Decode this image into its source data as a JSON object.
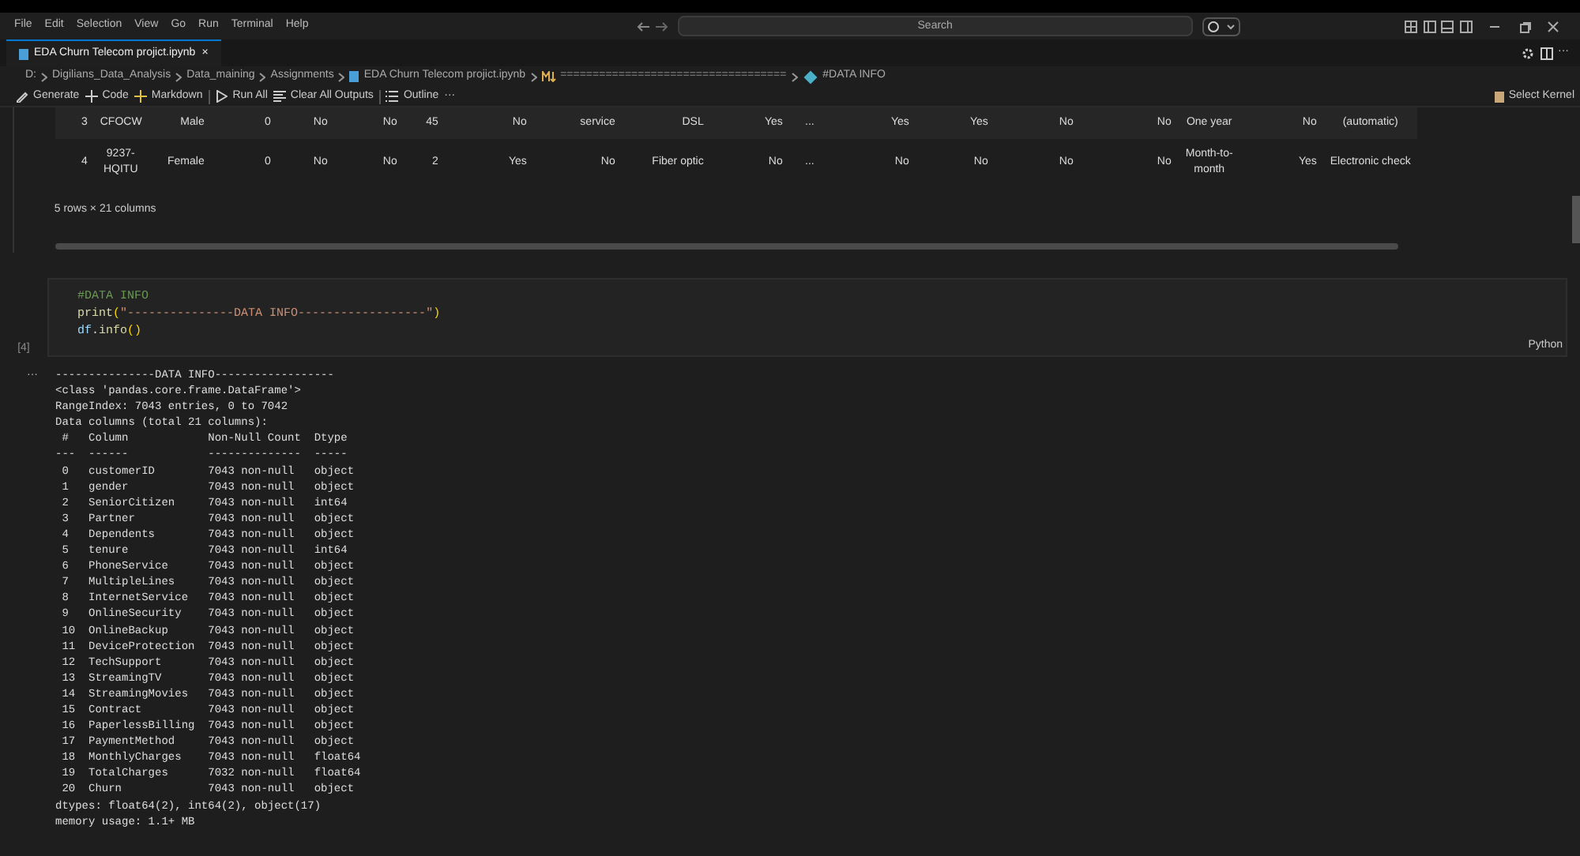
{
  "menu": [
    "File",
    "Edit",
    "Selection",
    "View",
    "Go",
    "Run",
    "Terminal",
    "Help"
  ],
  "search": {
    "placeholder": "Search"
  },
  "tabs": [
    {
      "label": "EDA Churn Telecom projict.ipynb",
      "selected": true,
      "close": "×"
    }
  ],
  "breadcrumb": [
    "D:",
    "Digilians_Data_Analysis",
    "Data_maining",
    "Assignments",
    "EDA Churn Telecom projict.ipynb",
    "===================================",
    "#DATA INFO"
  ],
  "toolbar": [
    {
      "label": "Generate",
      "kind": "sparkle"
    },
    {
      "label": "Code",
      "kind": "plus"
    },
    {
      "label": "Markdown",
      "kind": "plus"
    },
    {
      "label": "Run All",
      "kind": "run"
    },
    {
      "label": "Clear All Outputs",
      "kind": "clear"
    },
    {
      "label": "Outline",
      "kind": "list"
    },
    {
      "label": "···",
      "kind": "more"
    }
  ],
  "kernel": "Select Kernel",
  "table": {
    "rows": [
      [
        "3",
        "CFOCW",
        "Male",
        "0",
        "No",
        "No",
        "45",
        "No",
        "service",
        "DSL",
        "Yes",
        "...",
        "Yes",
        "Yes",
        "No",
        "No",
        "One year",
        "No",
        "(automatic)"
      ],
      [
        "4",
        "9237-HQITU",
        "Female",
        "0",
        "No",
        "No",
        "2",
        "Yes",
        "No",
        "Fiber optic",
        "No",
        "...",
        "No",
        "No",
        "No",
        "No",
        "Month-to-month",
        "Yes",
        "Electronic check"
      ]
    ],
    "summary": "5 rows × 21 columns"
  },
  "code_cell": {
    "lines": [
      [
        {
          "text": "#DATA INFO",
          "kind": "comment"
        }
      ],
      [
        {
          "text": "print",
          "kind": "func"
        },
        {
          "text": "(",
          "kind": "paren"
        },
        {
          "text": "\"---------------DATA INFO------------------\"",
          "kind": "string"
        },
        {
          "text": ")",
          "kind": "paren"
        }
      ],
      [
        {
          "text": "df",
          "kind": "var"
        },
        {
          "text": ".",
          "kind": "plain"
        },
        {
          "text": "info",
          "kind": "func"
        },
        {
          "text": "()",
          "kind": "paren"
        }
      ]
    ],
    "count": "[4]",
    "language": "Python"
  },
  "output": {
    "marker": "···",
    "lines": [
      "---------------DATA INFO------------------",
      "<class 'pandas.core.frame.DataFrame'>",
      "RangeIndex: 7043 entries, 0 to 7042",
      "Data columns (total 21 columns):",
      " #   Column            Non-Null Count  Dtype  ",
      "---  ------            --------------  -----  ",
      " 0   customerID        7043 non-null   object ",
      " 1   gender            7043 non-null   object ",
      " 2   SeniorCitizen     7043 non-null   int64  ",
      " 3   Partner           7043 non-null   object ",
      " 4   Dependents        7043 non-null   object ",
      " 5   tenure            7043 non-null   int64  ",
      " 6   PhoneService      7043 non-null   object ",
      " 7   MultipleLines     7043 non-null   object ",
      " 8   InternetService   7043 non-null   object ",
      " 9   OnlineSecurity    7043 non-null   object ",
      " 10  OnlineBackup      7043 non-null   object ",
      " 11  DeviceProtection  7043 non-null   object ",
      " 12  TechSupport       7043 non-null   object ",
      " 13  StreamingTV       7043 non-null   object ",
      " 14  StreamingMovies   7043 non-null   object ",
      " 15  Contract          7043 non-null   object ",
      " 16  PaperlessBilling  7043 non-null   object ",
      " 17  PaymentMethod     7043 non-null   object ",
      " 18  MonthlyCharges    7043 non-null   float64",
      " 19  TotalCharges      7032 non-null   float64",
      " 20  Churn             7043 non-null   object ",
      "dtypes: float64(2), int64(2), object(17)",
      "memory usage: 1.1+ MB"
    ]
  }
}
